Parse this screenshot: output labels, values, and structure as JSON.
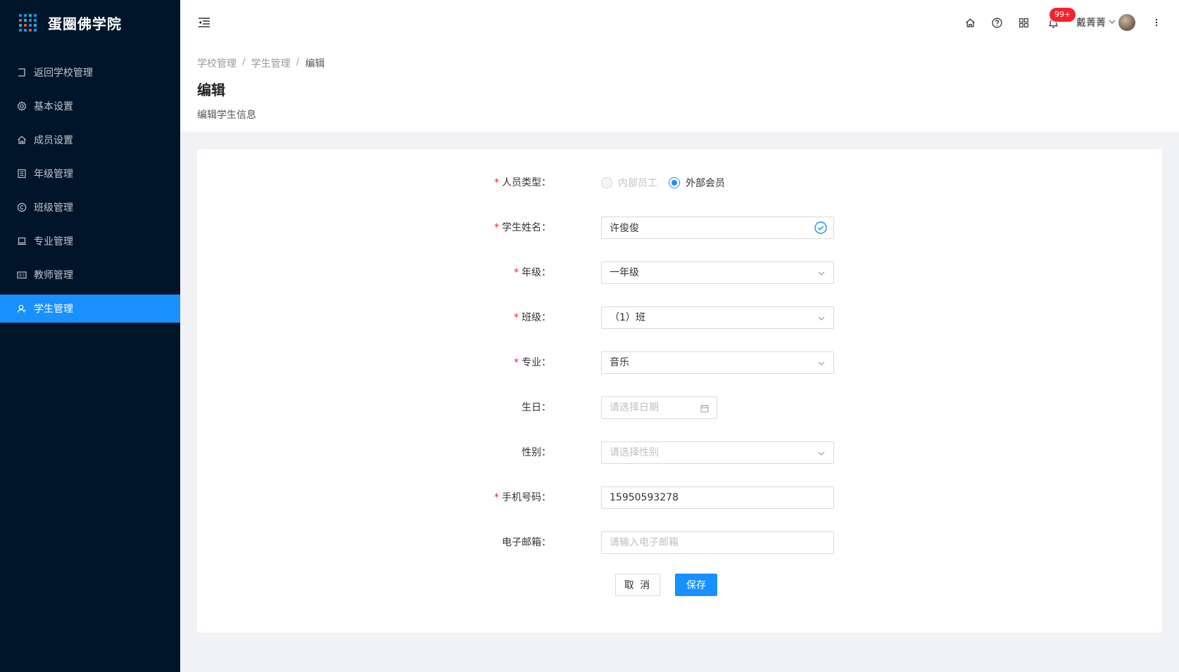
{
  "app": {
    "title": "蛋圈佛学院"
  },
  "sidebar": {
    "items": [
      {
        "label": "返回学校管理",
        "icon": "return-icon",
        "active": false
      },
      {
        "label": "基本设置",
        "icon": "gear-icon",
        "active": false
      },
      {
        "label": "成员设置",
        "icon": "home-icon",
        "active": false
      },
      {
        "label": "年级管理",
        "icon": "building-icon",
        "active": false
      },
      {
        "label": "班级管理",
        "icon": "copyright-icon",
        "active": false
      },
      {
        "label": "专业管理",
        "icon": "laptop-icon",
        "active": false
      },
      {
        "label": "教师管理",
        "icon": "id-card-icon",
        "active": false
      },
      {
        "label": "学生管理",
        "icon": "user-icon",
        "active": true
      }
    ]
  },
  "header": {
    "notification_count": "99+",
    "user_name": "戴菁菁",
    "icons": [
      "home-icon",
      "question-icon",
      "apps-icon",
      "bell-icon",
      "more-icon"
    ]
  },
  "breadcrumb": [
    "学校管理",
    "学生管理",
    "编辑"
  ],
  "page": {
    "title": "编辑",
    "description": "编辑学生信息"
  },
  "form": {
    "person_type": {
      "label": "人员类型",
      "options": [
        "内部员工",
        "外部会员"
      ],
      "selected": "外部会员"
    },
    "student_name": {
      "label": "学生姓名",
      "value": "许俊俊"
    },
    "grade": {
      "label": "年级",
      "value": "一年级"
    },
    "class": {
      "label": "班级",
      "value": "（1）班"
    },
    "major": {
      "label": "专业",
      "value": "音乐"
    },
    "birthday": {
      "label": "生日",
      "placeholder": "请选择日期"
    },
    "gender": {
      "label": "性别",
      "placeholder": "请选择性别"
    },
    "phone": {
      "label": "手机号码",
      "value": "15950593278"
    },
    "email": {
      "label": "电子邮箱",
      "placeholder": "请输入电子邮箱"
    },
    "cancel_label": "取 消",
    "save_label": "保存"
  },
  "colors": {
    "sidebar_bg": "#001529",
    "primary": "#1890ff",
    "required": "#f5222d",
    "success": "#1890ff"
  }
}
